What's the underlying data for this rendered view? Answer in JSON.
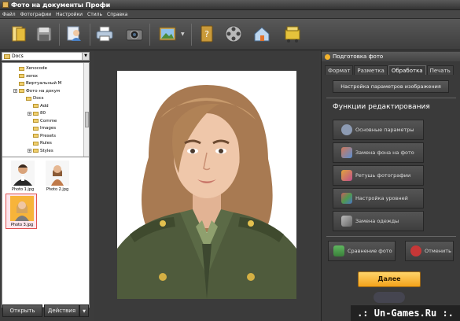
{
  "window": {
    "title": "Фото на документы Профи"
  },
  "menu": [
    "Файл",
    "Фотографии",
    "Настройки",
    "Стиль",
    "Справка"
  ],
  "toolbar": {
    "buttons": [
      {
        "name": "open-icon",
        "color": "#e7c046"
      },
      {
        "name": "save-icon",
        "color": "#8a8a8a"
      },
      {
        "name": "user-icon",
        "color": "#5a8fd1"
      },
      {
        "name": "print-icon",
        "color": "#9ab7d9"
      },
      {
        "name": "camera-icon",
        "color": "#777"
      },
      {
        "name": "image-icon",
        "color": "#7aaed8"
      },
      {
        "name": "help-book-icon",
        "color": "#d0a848"
      },
      {
        "name": "film-icon",
        "color": "#aaa"
      },
      {
        "name": "home-icon",
        "color": "#9fc3e6"
      },
      {
        "name": "shop-icon",
        "color": "#e3c23a"
      }
    ]
  },
  "folder_combo": {
    "value": "Docs"
  },
  "tree": {
    "items": [
      {
        "label": "Xenocode",
        "indent": 1,
        "plus": false
      },
      {
        "label": "xerox",
        "indent": 1,
        "plus": false
      },
      {
        "label": "Виртуальный М",
        "indent": 1,
        "plus": false
      },
      {
        "label": "Фото на докум",
        "indent": 1,
        "plus": true
      },
      {
        "label": "Docs",
        "indent": 2,
        "plus": false
      },
      {
        "label": "Add",
        "indent": 3,
        "plus": false
      },
      {
        "label": "80",
        "indent": 3,
        "plus": true
      },
      {
        "label": "Comme",
        "indent": 3,
        "plus": false
      },
      {
        "label": "Images",
        "indent": 3,
        "plus": false
      },
      {
        "label": "Presets",
        "indent": 3,
        "plus": false
      },
      {
        "label": "Rules",
        "indent": 3,
        "plus": false
      },
      {
        "label": "Styles",
        "indent": 3,
        "plus": true
      }
    ]
  },
  "photos": [
    {
      "caption": "Photo 1.jpg",
      "selected": false
    },
    {
      "caption": "Photo 2.jpg",
      "selected": false
    },
    {
      "caption": "Photo 3.jpg",
      "selected": true
    }
  ],
  "left_buttons": {
    "open": "Открыть",
    "actions": "Действия"
  },
  "right_panel": {
    "header": "Подготовка фото",
    "tabs": [
      "Формат",
      "Разметка",
      "Обработка",
      "Печать"
    ],
    "active_tab": 2,
    "settings_button": "Настройка параметров изображения",
    "section_title": "Функции редактирования",
    "functions": [
      {
        "label": "Основные параметры",
        "icon": "gear-icon",
        "color": "#8d9bb3"
      },
      {
        "label": "Замена фона на фото",
        "icon": "background-icon",
        "color": "#d0785a"
      },
      {
        "label": "Ретушь фотографии",
        "icon": "brush-icon",
        "color": "#e0a33c"
      },
      {
        "label": "Настройка уровней",
        "icon": "levels-icon",
        "color": "#c85e5e"
      },
      {
        "label": "Замена одежды",
        "icon": "clothes-icon",
        "color": "#9b9b9b"
      }
    ],
    "compare_button": "Сравнение фото",
    "undo_button": "Отменить",
    "next_button": "Далее"
  },
  "watermark": ".: Un-Games.Ru :."
}
